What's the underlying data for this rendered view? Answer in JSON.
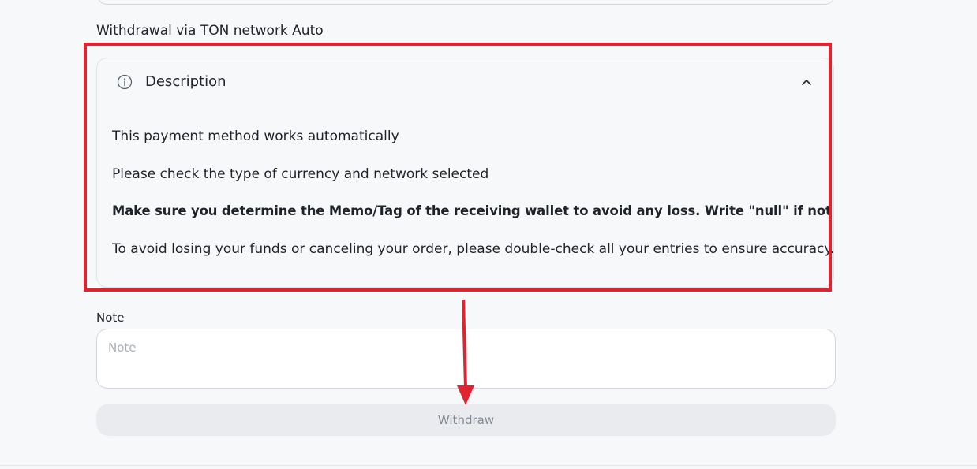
{
  "form": {
    "method_label": "Withdrawal via TON network Auto",
    "description": {
      "title": "Description",
      "expanded": true,
      "lines": [
        "This payment method works automatically",
        "Please check the type of currency and network selected",
        "Make sure you determine the Memo/Tag of the receiving wallet to avoid any loss. Write \"null\" if not a required",
        "To avoid losing your funds or canceling your order, please double-check all your entries to ensure accuracy."
      ]
    },
    "note": {
      "label": "Note",
      "placeholder": "Note",
      "value": ""
    },
    "withdraw_label": "Withdraw",
    "withdraw_disabled": true
  },
  "annotation": {
    "highlight_color": "#e0232e"
  },
  "icons": {
    "info": "info-circle-icon",
    "chevron": "chevron-up-icon"
  }
}
